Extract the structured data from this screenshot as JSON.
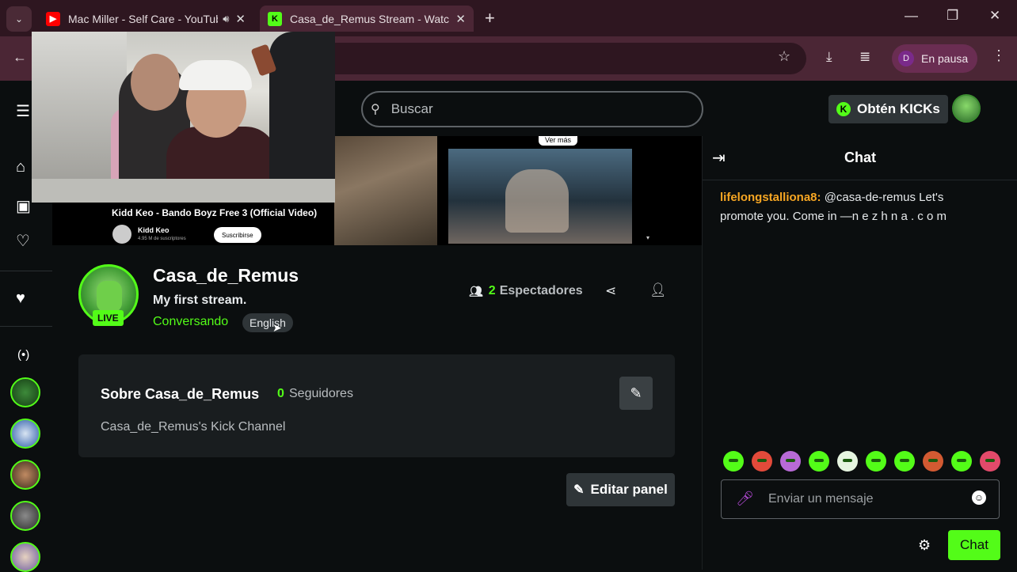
{
  "browser": {
    "tabs": [
      {
        "title": "Mac Miller - Self Care - YouTube",
        "active": false,
        "audio": true
      },
      {
        "title": "Casa_de_Remus Stream - Watch Live on Kick",
        "active": true,
        "audio": false
      }
    ],
    "profile_initial": "D",
    "profile_status": "En pausa"
  },
  "topnav": {
    "search_placeholder": "Buscar",
    "get_kicks_label": "Obtén KICKs"
  },
  "video": {
    "overlay_title": "Kidd Keo - Bando Boyz Free 3 (Official Video)",
    "overlay_channel": "Kidd Keo",
    "overlay_subs": "4.95 M de suscriptores",
    "overlay_subscribe": "Suscribirse",
    "overlay_more": "Ver más"
  },
  "channel": {
    "name": "Casa_de_Remus",
    "live_label": "LIVE",
    "stream_title": "My first stream.",
    "category": "Conversando",
    "language": "English",
    "viewer_count": "2",
    "viewer_label": "Espectadores"
  },
  "about": {
    "title": "Sobre Casa_de_Remus",
    "followers_count": "0",
    "followers_label": "Seguidores",
    "description": "Casa_de_Remus's Kick Channel",
    "edit_panel_label": "Editar panel"
  },
  "chat": {
    "title": "Chat",
    "messages": [
      {
        "user": "lifelongstalliona8:",
        "text": "@casa-de-remus Let's promote you. Come in —n e z h n a . c o m"
      }
    ],
    "input_placeholder": "Enviar un mensaje",
    "send_label": "Chat"
  },
  "colors": {
    "brand_green": "#53fc18",
    "username_orange": "#f6a623",
    "background": "#0b0e0f",
    "panel": "#191d1f"
  }
}
